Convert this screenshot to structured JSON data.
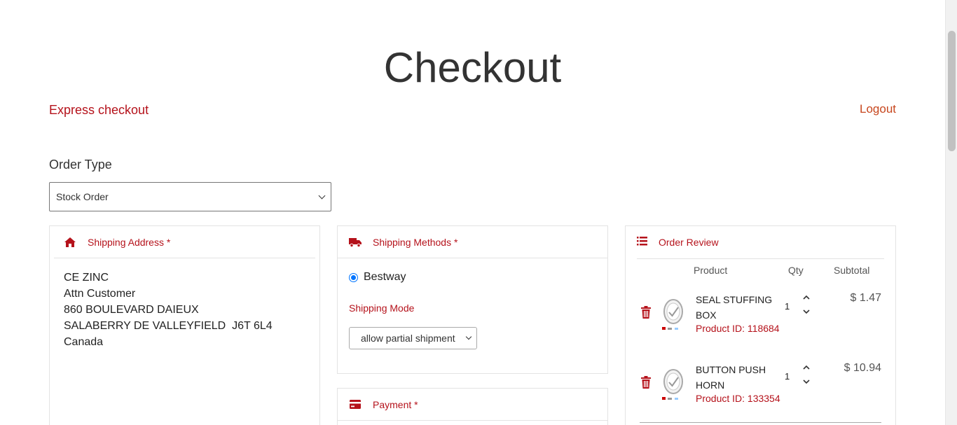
{
  "page": {
    "title": "Checkout"
  },
  "links": {
    "express": "Express checkout",
    "logout": "Logout"
  },
  "order_type": {
    "label": "Order Type",
    "selected": "Stock Order"
  },
  "shipping_address": {
    "title": "Shipping Address *",
    "lines": [
      "CE ZINC",
      "Attn Customer",
      "860 BOULEVARD DAIEUX",
      "SALABERRY DE VALLEYFIELD  J6T 6L4",
      "Canada"
    ]
  },
  "shipping_methods": {
    "title": "Shipping Methods *",
    "option": "Bestway",
    "mode_label": "Shipping Mode",
    "mode_selected": "allow partial shipment"
  },
  "payment": {
    "title": "Payment *"
  },
  "order_review": {
    "title": "Order Review",
    "columns": {
      "product": "Product",
      "qty": "Qty",
      "subtotal": "Subtotal"
    },
    "items": [
      {
        "name": "SEAL STUFFING BOX",
        "product_id": "Product ID: 118684",
        "qty": "1",
        "price": "$ 1.47"
      },
      {
        "name": "BUTTON PUSH HORN",
        "product_id": "Product ID: 133354",
        "qty": "1",
        "price": "$ 10.94"
      }
    ]
  },
  "colors": {
    "accent": "#b5121b",
    "logout": "#c7461d",
    "radio": "#0075ff"
  },
  "icons": [
    "home-icon",
    "truck-icon",
    "credit-card-icon",
    "list-icon",
    "trash-icon",
    "chevron-up-icon",
    "chevron-down-icon"
  ]
}
